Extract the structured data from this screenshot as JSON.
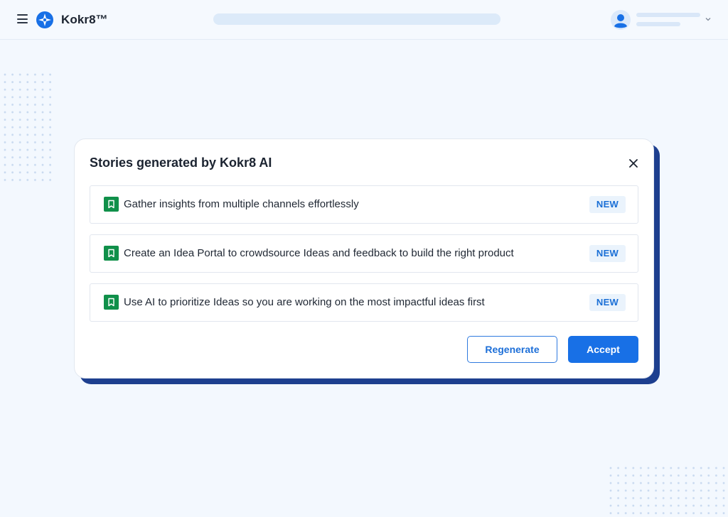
{
  "header": {
    "app_title": "Kokr8™",
    "menu_icon": "hamburger-menu-icon",
    "logo_icon": "compass-star-logo-icon",
    "avatar_icon": "user-avatar-icon",
    "chevron_icon": "chevron-down-icon"
  },
  "modal": {
    "title": "Stories generated by Kokr8 AI",
    "close_icon": "close-icon",
    "stories": [
      {
        "icon": "bookmark-icon",
        "text": "Gather insights from multiple channels effortlessly",
        "badge": "NEW"
      },
      {
        "icon": "bookmark-icon",
        "text": "Create an Idea Portal to crowdsource Ideas and feedback to build the right product",
        "badge": "NEW"
      },
      {
        "icon": "bookmark-icon",
        "text": "Use AI to prioritize Ideas so you are working on the most impactful ideas first",
        "badge": "NEW"
      }
    ],
    "buttons": {
      "regenerate_label": "Regenerate",
      "accept_label": "Accept"
    }
  },
  "colors": {
    "background": "#f3f8fe",
    "accent": "#1870e6",
    "modal_shadow": "#1d3f8f",
    "story_icon": "#10904a",
    "badge_bg": "#eaf3fc",
    "badge_text": "#1a6fd6"
  }
}
